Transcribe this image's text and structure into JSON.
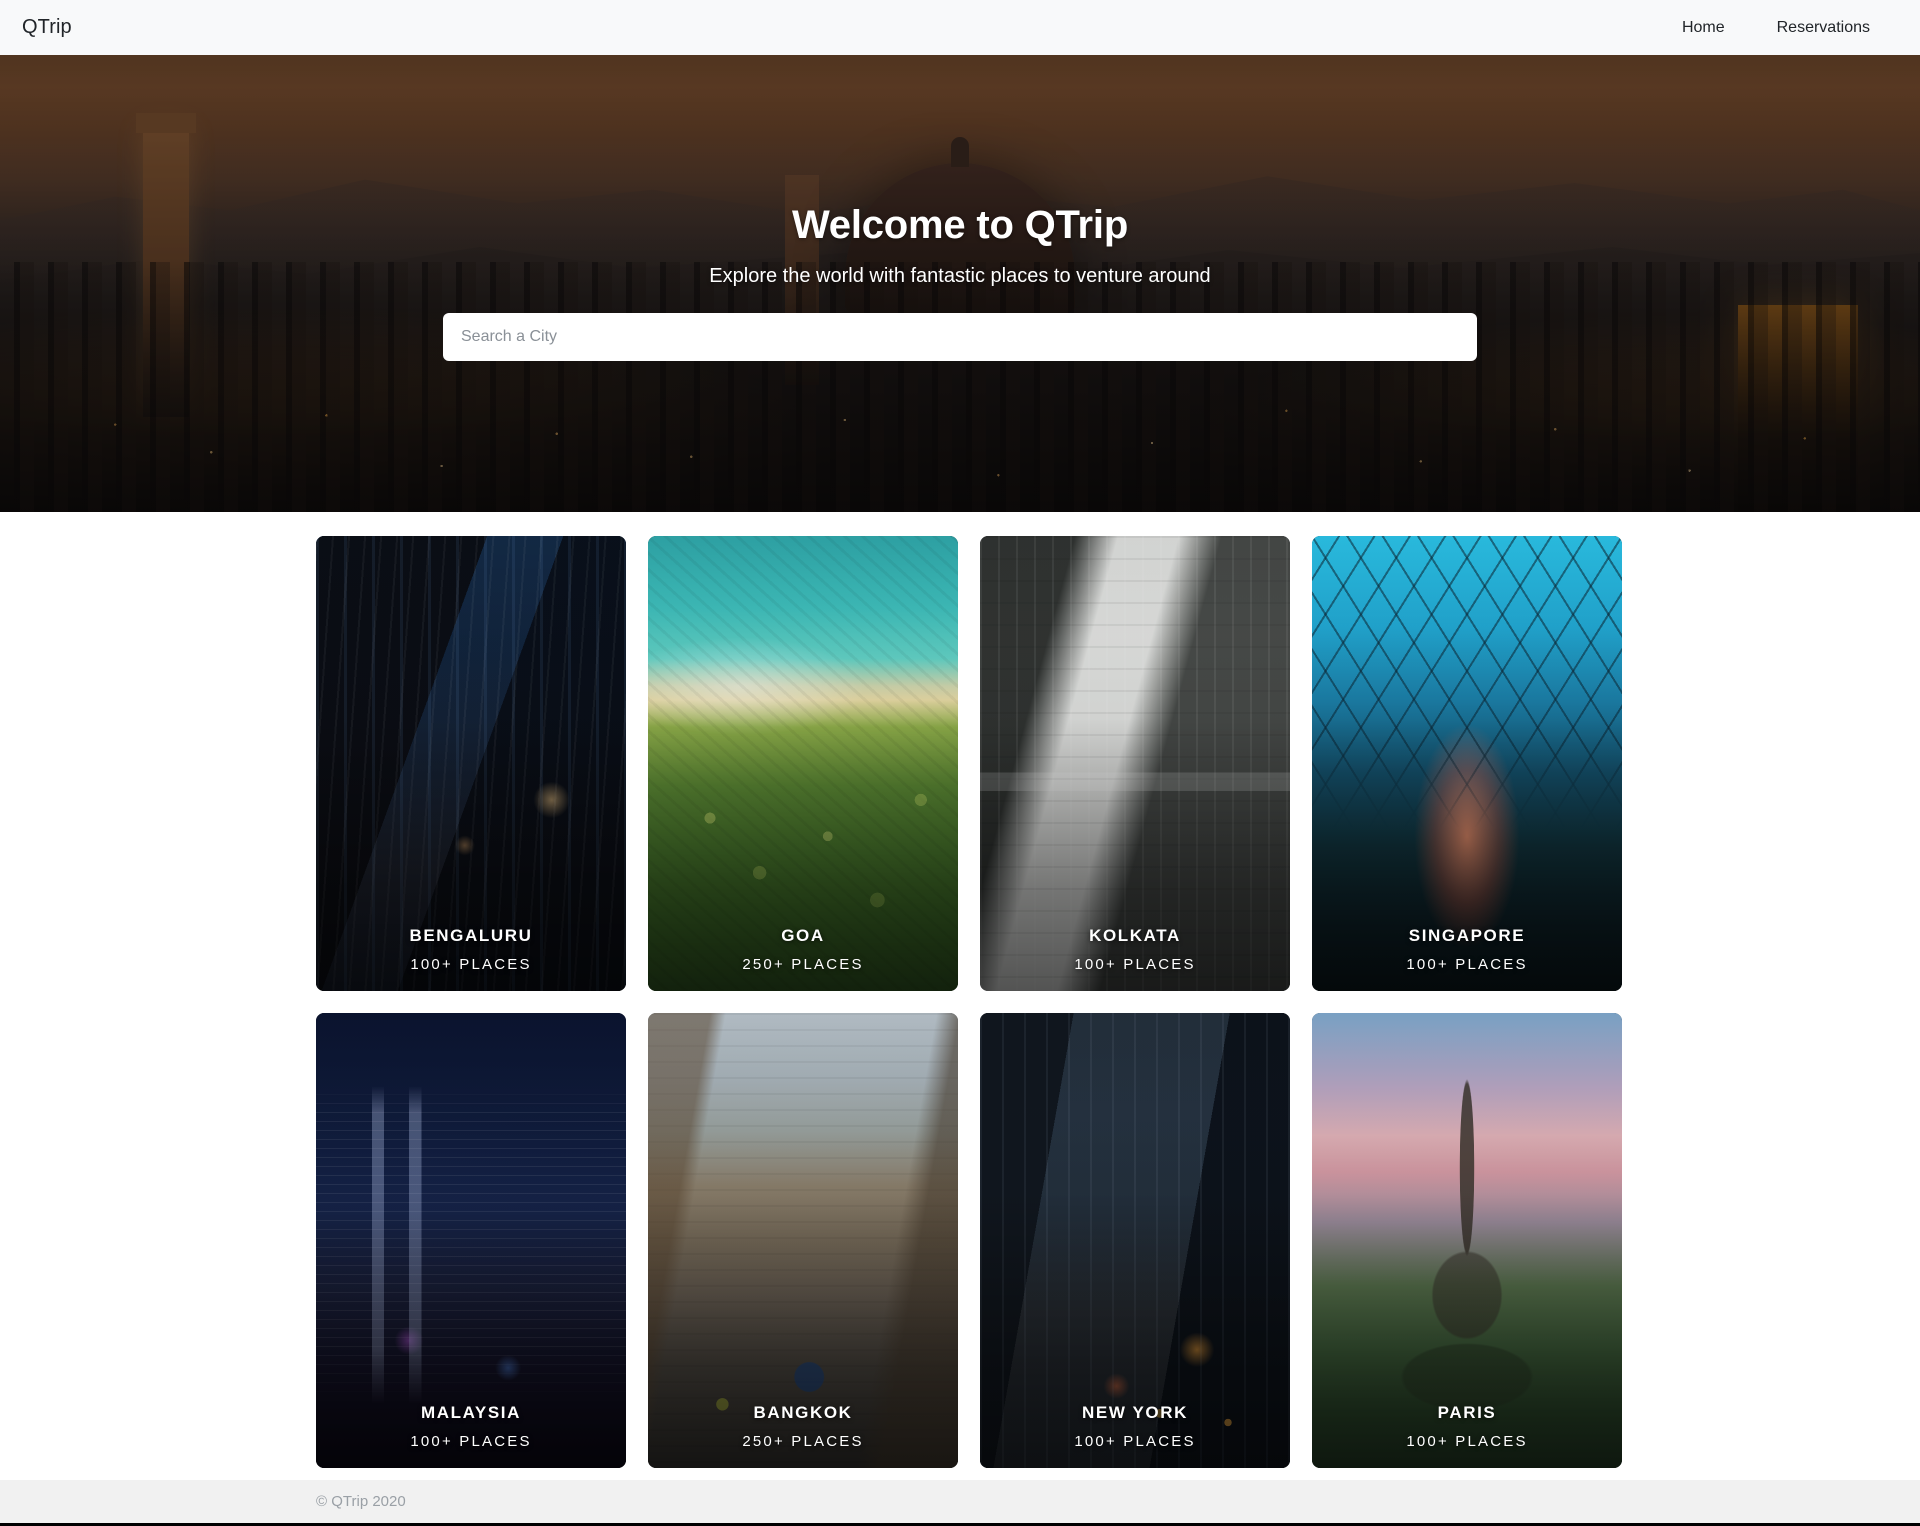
{
  "navbar": {
    "brand": "QTrip",
    "links": [
      {
        "label": "Home",
        "name": "nav-link-home"
      },
      {
        "label": "Reservations",
        "name": "nav-link-reservations"
      }
    ]
  },
  "hero": {
    "title": "Welcome to QTrip",
    "subtitle": "Explore the world with fantastic places to venture around",
    "search_placeholder": "Search a City",
    "search_value": ""
  },
  "cities": [
    {
      "name": "BENGALURU",
      "places": "100+ PLACES",
      "art": "img-bengaluru"
    },
    {
      "name": "GOA",
      "places": "250+ PLACES",
      "art": "img-goa"
    },
    {
      "name": "KOLKATA",
      "places": "100+ PLACES",
      "art": "img-kolkata"
    },
    {
      "name": "SINGAPORE",
      "places": "100+ PLACES",
      "art": "img-singapore"
    },
    {
      "name": "MALAYSIA",
      "places": "100+ PLACES",
      "art": "img-malaysia"
    },
    {
      "name": "BANGKOK",
      "places": "250+ PLACES",
      "art": "img-bangkok"
    },
    {
      "name": "NEW YORK",
      "places": "100+ PLACES",
      "art": "img-newyork"
    },
    {
      "name": "PARIS",
      "places": "100+ PLACES",
      "art": "img-paris"
    }
  ],
  "footer": {
    "copyright": "© QTrip 2020"
  },
  "colors": {
    "navbar_bg": "#f8f9fa",
    "brand_text": "#212529",
    "hero_text": "#ffffff",
    "footer_bg": "#f0f0f0",
    "footer_text": "#9aa0a6"
  }
}
